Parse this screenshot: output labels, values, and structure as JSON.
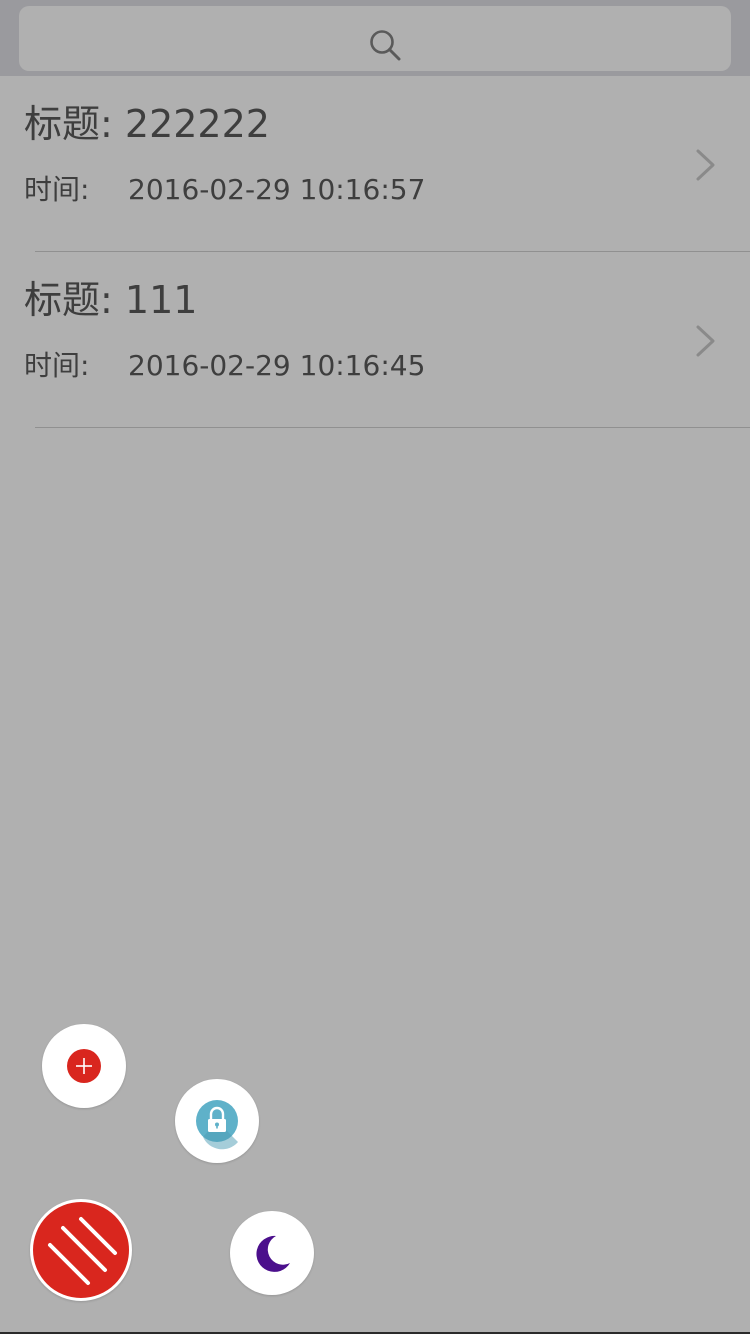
{
  "search": {
    "placeholder": "",
    "icon": "search-icon"
  },
  "notes": [
    {
      "title_prefix": "标题:",
      "title": "222222",
      "time_label": "时间:",
      "time": "2016-02-29 10:16:57"
    },
    {
      "title_prefix": "标题:",
      "title": "111",
      "time_label": "时间:",
      "time": "2016-02-29 10:16:45"
    }
  ],
  "actions": {
    "add_icon": "plus-circle-icon",
    "lock_icon": "lock-icon",
    "night_icon": "moon-icon",
    "menu_icon": "menu-stripes-icon"
  },
  "colors": {
    "background": "#b0b0b0",
    "header": "#9a9a9e",
    "accent_red": "#d9261e",
    "lock_teal": "#5fb1c9",
    "moon_purple": "#4b0f8c"
  }
}
